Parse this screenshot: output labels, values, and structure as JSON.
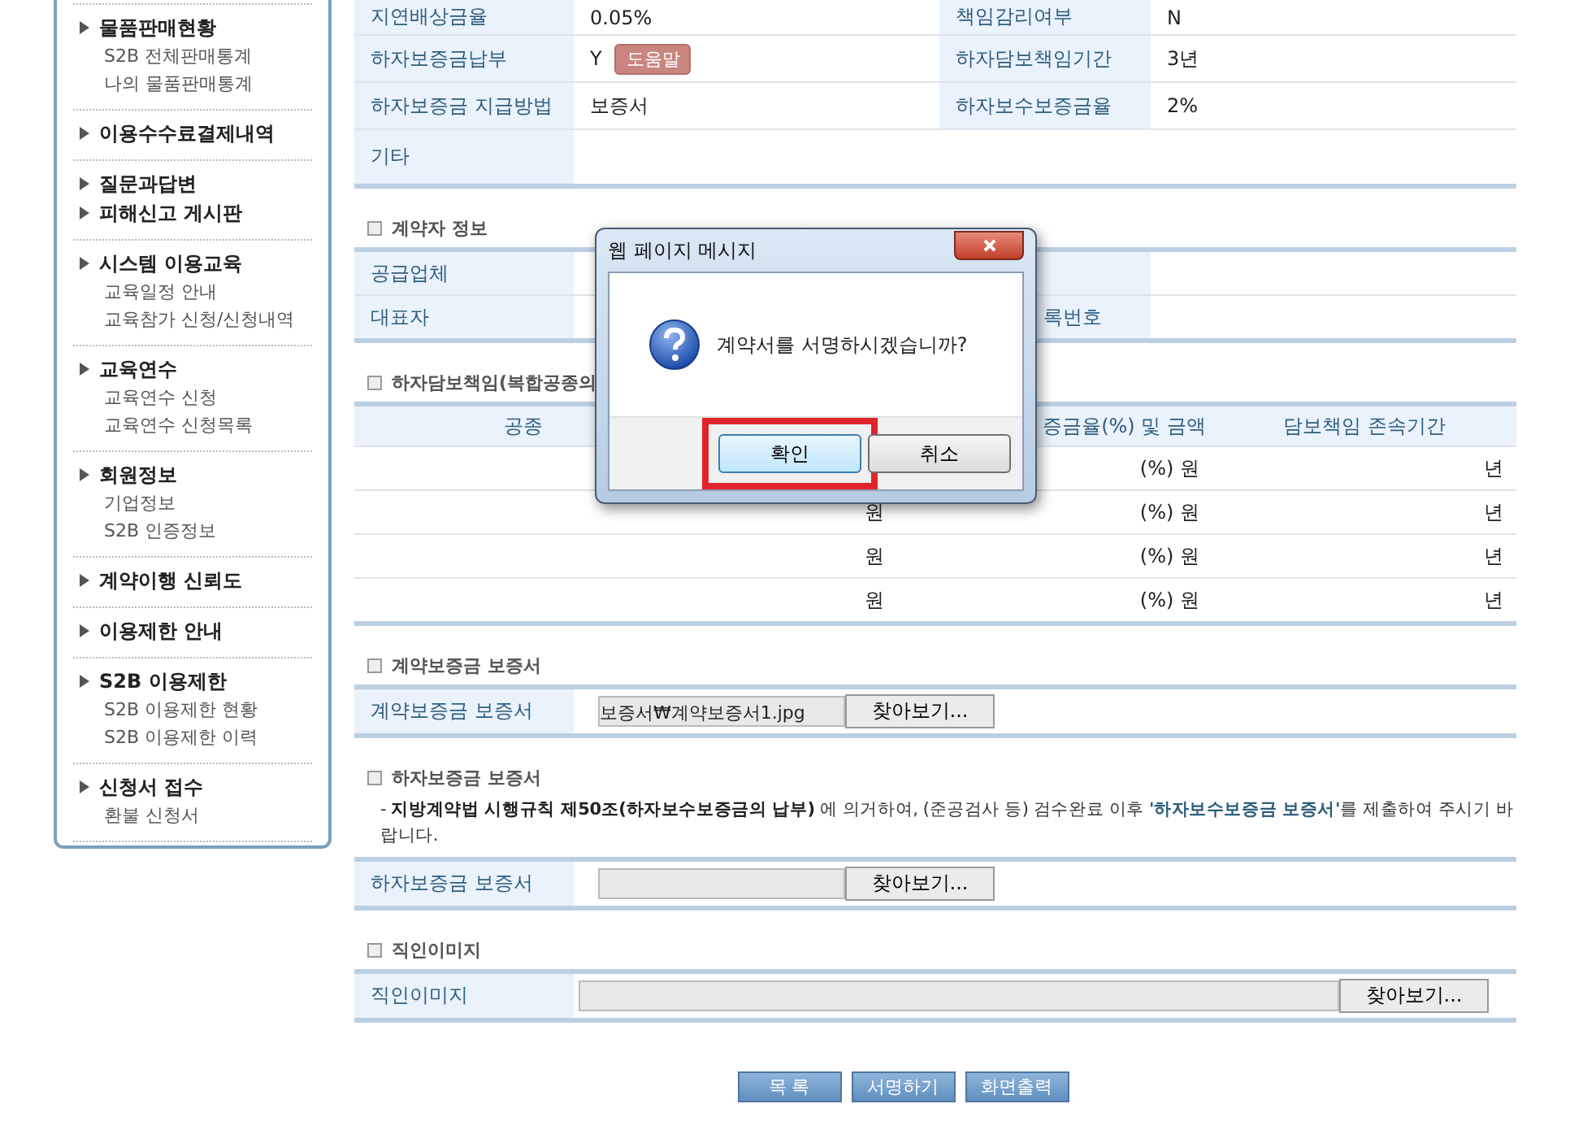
{
  "sidebar": {
    "groups": [
      {
        "entries": [
          {
            "label": "물품판매현황",
            "children": [
              {
                "label": "S2B 전체판매통계"
              },
              {
                "label": "나의 물품판매통계"
              }
            ]
          }
        ]
      },
      {
        "entries": [
          {
            "label": "이용수수료결제내역"
          }
        ]
      },
      {
        "entries": [
          {
            "label": "질문과답변"
          },
          {
            "label": "피해신고 게시판"
          }
        ]
      },
      {
        "entries": [
          {
            "label": "시스템 이용교육",
            "children": [
              {
                "label": "교육일정 안내"
              },
              {
                "label": "교육참가 신청/신청내역"
              }
            ]
          }
        ]
      },
      {
        "entries": [
          {
            "label": "교육연수",
            "children": [
              {
                "label": "교육연수 신청"
              },
              {
                "label": "교육연수 신청목록"
              }
            ]
          }
        ]
      },
      {
        "entries": [
          {
            "label": "회원정보",
            "children": [
              {
                "label": "기업정보"
              },
              {
                "label": "S2B 인증정보"
              }
            ]
          }
        ]
      },
      {
        "entries": [
          {
            "label": "계약이행 신뢰도"
          }
        ]
      },
      {
        "entries": [
          {
            "label": "이용제한 안내"
          }
        ]
      },
      {
        "entries": [
          {
            "label": "S2B 이용제한",
            "children": [
              {
                "label": "S2B 이용제한 현황"
              },
              {
                "label": "S2B 이용제한 이력"
              }
            ]
          }
        ]
      },
      {
        "entries": [
          {
            "label": "신청서 접수",
            "children": [
              {
                "label": "환불 신청서"
              }
            ]
          }
        ]
      }
    ]
  },
  "details": {
    "rows": [
      {
        "cells": [
          {
            "label": "지연배상금율",
            "value": "0.05%"
          },
          {
            "label": "책임감리여부",
            "value": "N"
          }
        ]
      },
      {
        "cells": [
          {
            "label": "하자보증금납부",
            "value": "Y",
            "help_button": "도움말"
          },
          {
            "label": "하자담보책임기간",
            "value": "3년"
          }
        ]
      },
      {
        "cells": [
          {
            "label": "하자보증금 지급방법",
            "value": "보증서"
          },
          {
            "label": "하자보수보증금율",
            "value": "2%"
          }
        ]
      },
      {
        "cells": [
          {
            "label": "기타",
            "wide": true
          }
        ]
      }
    ]
  },
  "contractor": {
    "title": "계약자 정보",
    "rows": [
      {
        "cells": [
          {
            "label": "공급업체"
          }
        ]
      },
      {
        "cells": [
          {
            "label": "대표자"
          },
          {
            "label": "록번호"
          }
        ]
      }
    ]
  },
  "warranty": {
    "title": "하자담보책임(복합공종의",
    "columns": [
      "공종",
      null,
      "증금율(%) 및 금액",
      "담보책임 존속기간"
    ],
    "rows": [
      {
        "cells": [
          null,
          null,
          "(%) 원",
          "년"
        ]
      },
      {
        "cells": [
          null,
          "원",
          "(%) 원",
          "년"
        ]
      },
      {
        "cells": [
          null,
          "원",
          "(%) 원",
          "년"
        ]
      },
      {
        "cells": [
          null,
          "원",
          "(%) 원",
          "년"
        ]
      }
    ]
  },
  "contract_bond": {
    "title": "계약보증금 보증서",
    "label": "계약보증금 보증서",
    "value": "보증서₩계약보증서1.jpg",
    "button": "찾아보기..."
  },
  "defect_bond": {
    "title": "하자보증금 보증서",
    "note": [
      {
        "kind": "plain",
        "text": "- "
      },
      {
        "kind": "bold",
        "text": "지방계약법 시행규칙 제50조(하자보수보증금의 납부)"
      },
      {
        "kind": "plain",
        "text": " 에 의거하여, (준공검사 등) 검수완료 이후 "
      },
      {
        "kind": "highlight",
        "text": "'하자보수보증금 보증서'"
      },
      {
        "kind": "plain",
        "text": "를 제출하여 주시기 바랍니다."
      }
    ],
    "label": "하자보증금 보증서",
    "button": "찾아보기..."
  },
  "seal_image": {
    "title": "직인이미지",
    "label": "직인이미지",
    "button": "찾아보기..."
  },
  "actions": [
    "목 록",
    "서명하기",
    "화면출력"
  ],
  "dialog": {
    "title": "웹 페이지 메시지",
    "message": "계약서를 서명하시겠습니까?",
    "buttons": [
      {
        "label": "확인",
        "focused": true,
        "outlined": true
      },
      {
        "label": "취소",
        "focused": false,
        "outlined": false
      }
    ]
  }
}
